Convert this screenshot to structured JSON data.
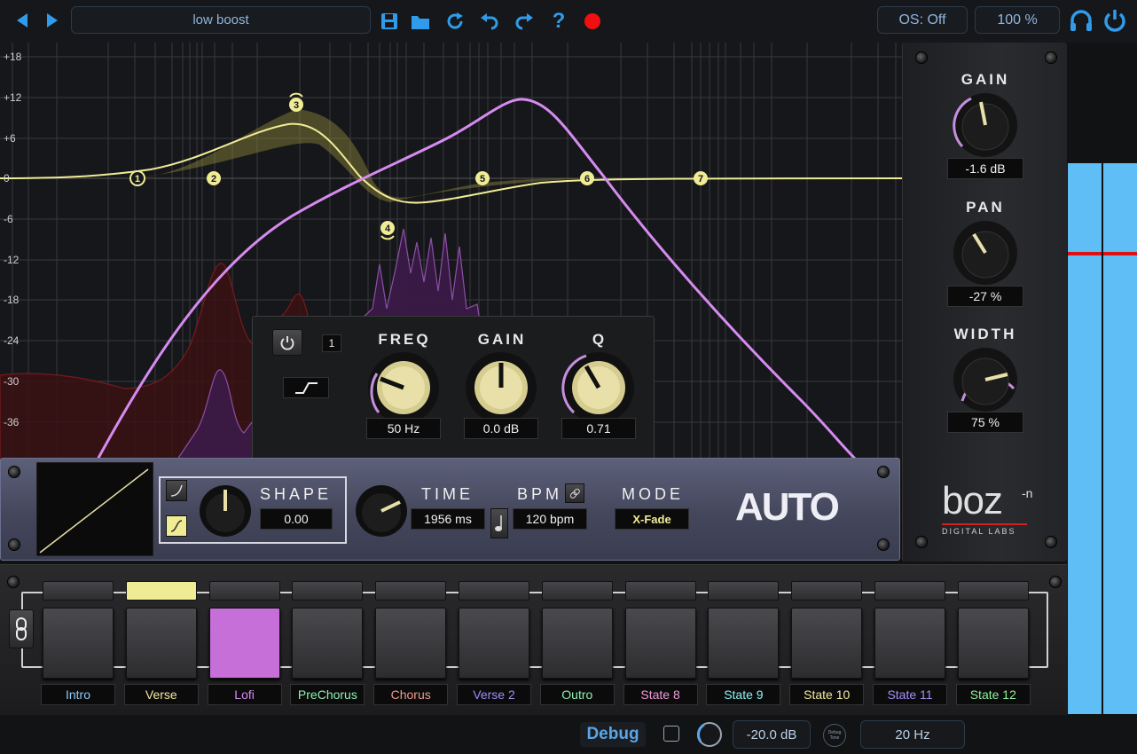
{
  "header": {
    "preset_name": "low boost",
    "os_label": "OS: Off",
    "zoom": "100 %",
    "icons": [
      "prev-icon",
      "next-icon",
      "save-icon",
      "folder-icon",
      "refresh-icon",
      "undo-icon",
      "redo-icon",
      "help-icon",
      "record-icon",
      "headphones-icon",
      "power-icon"
    ]
  },
  "eq": {
    "db_labels": [
      "+18",
      "+12",
      "+6",
      "0",
      "-6",
      "-12",
      "-18",
      "-24",
      "-30",
      "-36"
    ],
    "nodes": [
      "1",
      "2",
      "3",
      "4",
      "5",
      "6",
      "7"
    ]
  },
  "band_panel": {
    "band_number": "1",
    "freq_label": "FREQ",
    "freq_value": "50 Hz",
    "gain_label": "GAIN",
    "gain_value": "0.0 dB",
    "q_label": "Q",
    "q_value": "0.71",
    "filter_shape": "low-shelf-icon"
  },
  "output": {
    "gain_label": "GAIN",
    "gain_value": "-1.6 dB",
    "pan_label": "PAN",
    "pan_value": "-27 %",
    "width_label": "WIDTH",
    "width_value": "75 %",
    "brand": "boz",
    "brand_sup": "-n",
    "brand_sub": "DIGITAL LABS"
  },
  "auto": {
    "shape_label": "SHAPE",
    "shape_value": "0.00",
    "time_label": "TIME",
    "time_value": "1956 ms",
    "bpm_label": "BPM",
    "bpm_value": "120 bpm",
    "mode_label": "MODE",
    "mode_value": "X-Fade",
    "logo": "AUTO"
  },
  "states": [
    {
      "label": "Intro",
      "color": "#8ec8f5"
    },
    {
      "label": "Verse",
      "color": "#f2ea9c"
    },
    {
      "label": "Lofi",
      "color": "#d78bf2"
    },
    {
      "label": "PreChorus",
      "color": "#8ff0b0"
    },
    {
      "label": "Chorus",
      "color": "#f09a8c"
    },
    {
      "label": "Verse 2",
      "color": "#9c8ff5"
    },
    {
      "label": "Outro",
      "color": "#8ff0b0"
    },
    {
      "label": "State 8",
      "color": "#f29ad8"
    },
    {
      "label": "State 9",
      "color": "#8ff0f0"
    },
    {
      "label": "State 10",
      "color": "#f2ea9c"
    },
    {
      "label": "State 11",
      "color": "#a58ff5"
    },
    {
      "label": "State 12",
      "color": "#8ff09a"
    }
  ],
  "footer": {
    "debug_label": "Debug",
    "level_value": "-20.0 dB",
    "freq_value": "20 Hz",
    "knob_caption": "Debug Tone"
  },
  "colors": {
    "accent": "#2f9bea",
    "eq_curve": "#f0ec96",
    "filter_curve": "#d58bf0",
    "meter": "#5fbef5"
  }
}
